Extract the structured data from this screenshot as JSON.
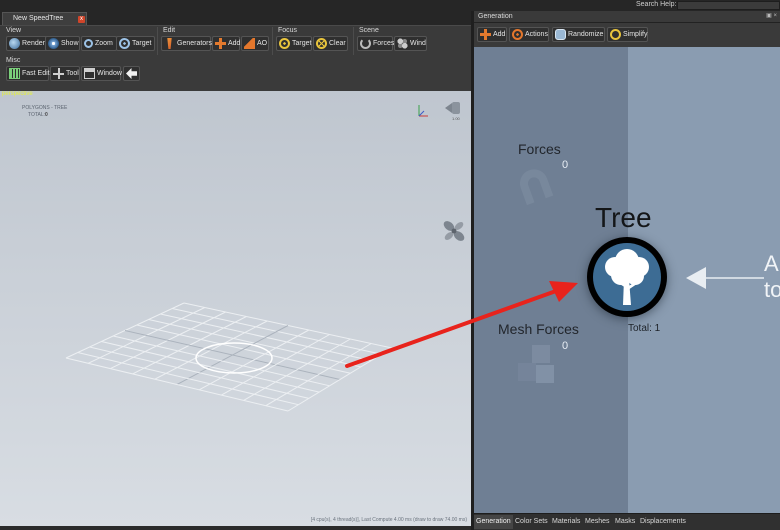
{
  "header": {
    "search_label": "Search Help:",
    "search_value": ""
  },
  "document": {
    "tab_label": "New SpeedTree",
    "close_glyph": "x"
  },
  "toolbar": {
    "view": {
      "title": "View",
      "render": "Render",
      "show": "Show",
      "zoom": "Zoom",
      "target": "Target"
    },
    "edit": {
      "title": "Edit",
      "generators": "Generators",
      "add": "Add",
      "ao": "AO"
    },
    "focus": {
      "title": "Focus",
      "target": "Target",
      "clear": "Clear"
    },
    "scene": {
      "title": "Scene",
      "forces": "Forces",
      "wind": "Wind"
    },
    "misc": {
      "title": "Misc",
      "fast_edit": "Fast Edit",
      "tool": "Tool",
      "window": "Window"
    }
  },
  "viewport": {
    "mode_label": "perspective",
    "polygons_label": "POLYGONS - TREE",
    "total_label": "TOTAL:",
    "total_value": "0",
    "camera_value": "1.00",
    "stats": "[4 cpu(s), 4 thread(s)], Last Compute 4.00 ms (draw to draw 74.00 ms)"
  },
  "generation_panel": {
    "title": "Generation",
    "window_buttons": "▣ ×",
    "toolbar": {
      "add": "Add",
      "actions": "Actions",
      "randomize": "Randomize",
      "simplify": "Simplify"
    },
    "nodes": {
      "forces_label": "Forces",
      "forces_count": "0",
      "mesh_forces_label": "Mesh Forces",
      "mesh_forces_count": "0",
      "tree_label": "Tree",
      "tree_total": "Total: 1"
    },
    "hint_text": "A\nto"
  },
  "bottom_tabs": [
    "Generation",
    "Color Sets",
    "Materials",
    "Meshes",
    "Masks",
    "Displacements"
  ],
  "colors": {
    "accent_red": "#e8231c",
    "tree_node_fill": "#3d6c94"
  }
}
